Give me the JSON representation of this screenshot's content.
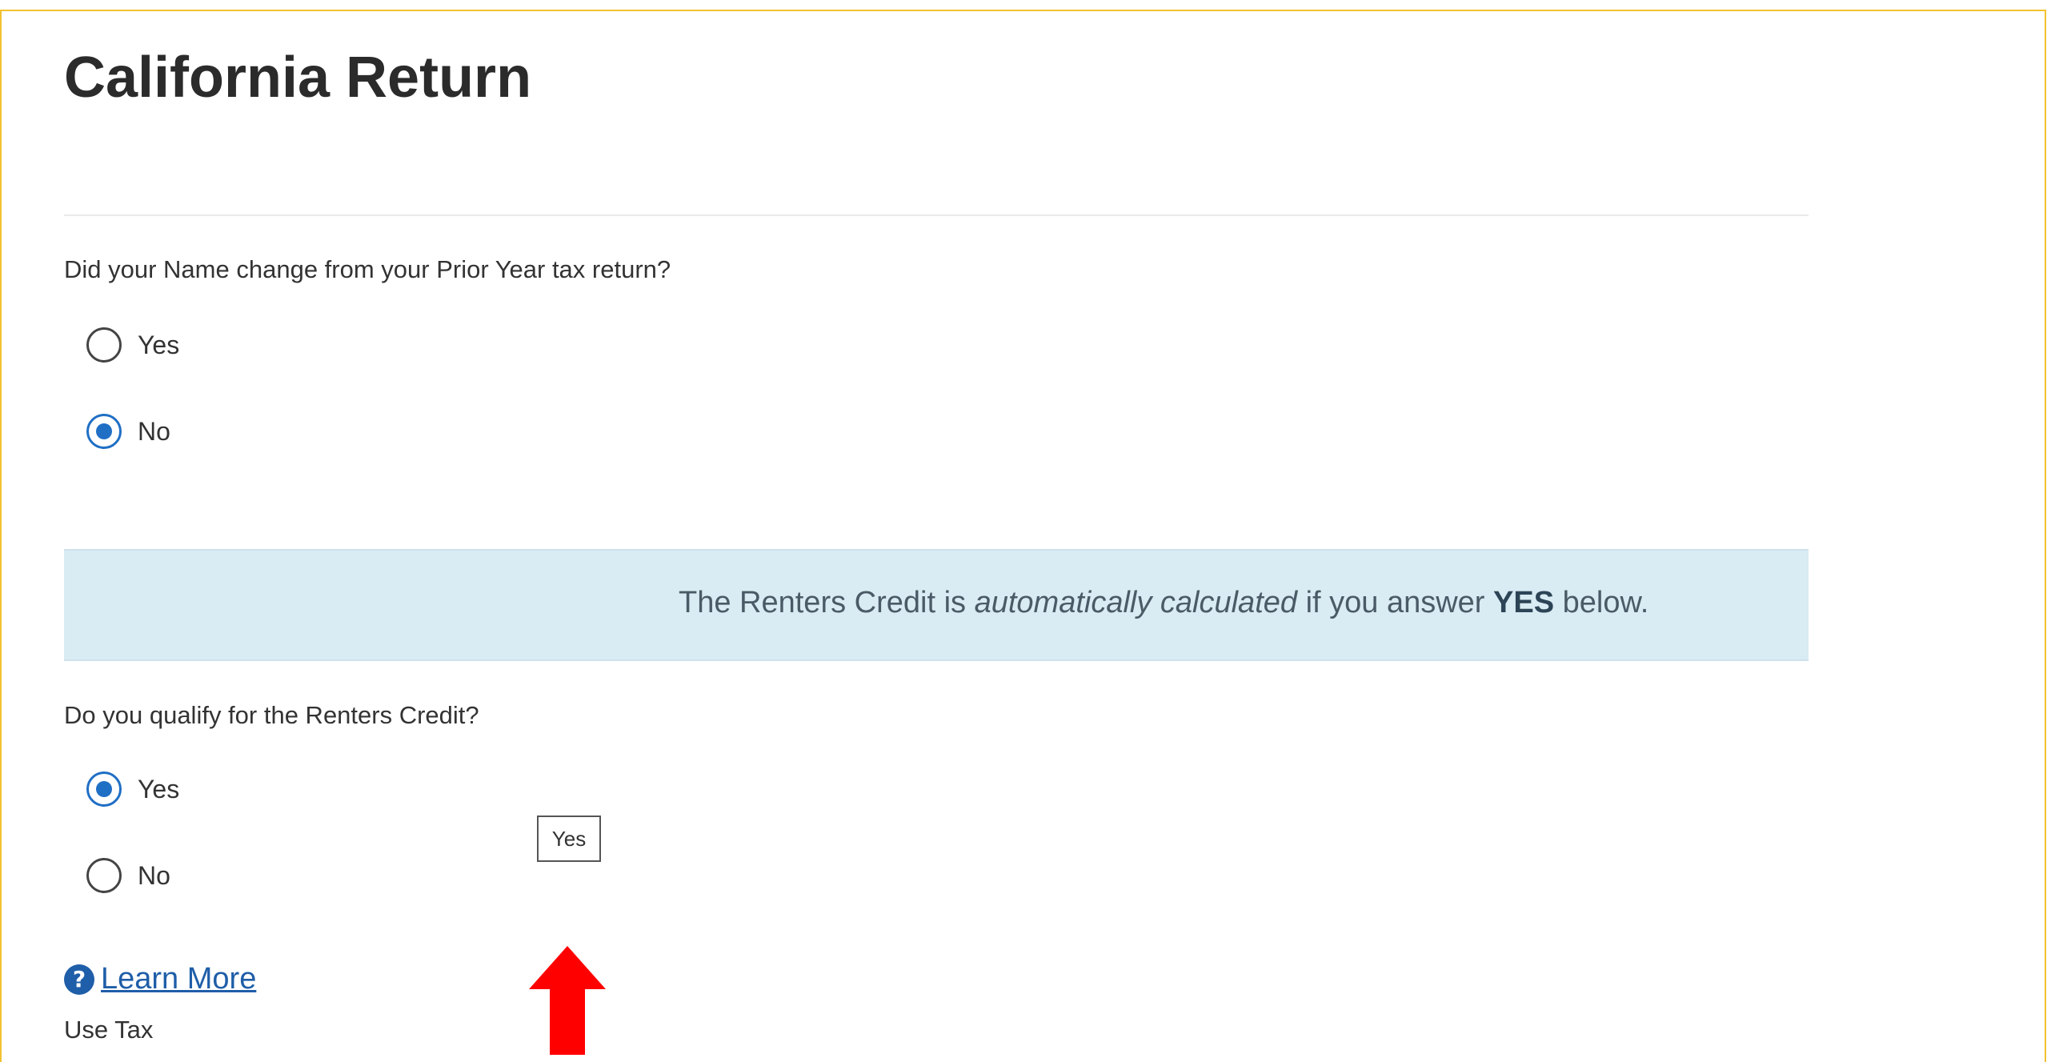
{
  "page": {
    "title": "California Return"
  },
  "name_change": {
    "question": "Did your Name change from your Prior Year tax return?",
    "options": [
      {
        "label": "Yes",
        "checked": false
      },
      {
        "label": "No",
        "checked": true
      }
    ]
  },
  "banner": {
    "text_prefix": "The Renters Credit is ",
    "text_emphasis": "automatically calculated",
    "text_middle": " if you answer ",
    "text_strong": "YES",
    "text_suffix": " below."
  },
  "renters_credit": {
    "question": "Do you qualify for the Renters Credit?",
    "options": [
      {
        "label": "Yes",
        "checked": true
      },
      {
        "label": "No",
        "checked": false
      }
    ],
    "tooltip": "Yes"
  },
  "learn_more": {
    "icon": "question-circle-icon",
    "label": "Learn More"
  },
  "use_tax": {
    "label": "Use Tax"
  },
  "colors": {
    "frame_border": "#f2c230",
    "accent_blue": "#1f6fc5",
    "banner_bg": "#d9ebf3",
    "arrow_red": "#ff0000"
  },
  "annotation": {
    "icon": "red-up-arrow-icon"
  }
}
